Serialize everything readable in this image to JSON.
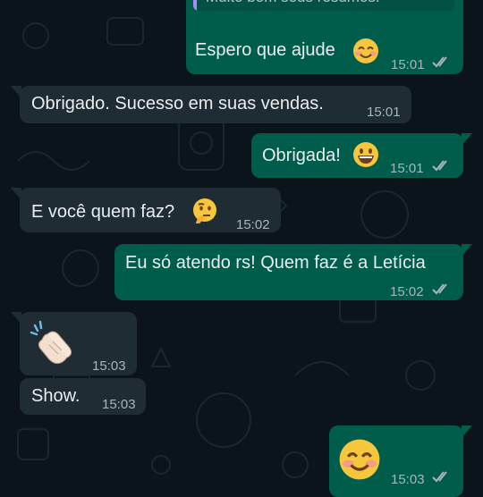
{
  "chat": {
    "colors": {
      "outgoing": "#005c4b",
      "incoming": "#202c33",
      "read_ticks": "#a8b5bc"
    },
    "messages": [
      {
        "direction": "out",
        "quoted_text": "Muito bom seus resumos.",
        "text": "Espero que ajude",
        "emoji": "smiling-face-icon",
        "time": "15:01",
        "status": "read"
      },
      {
        "direction": "in",
        "text": "Obrigado. Sucesso em suas vendas.",
        "time": "15:01"
      },
      {
        "direction": "out",
        "text": "Obrigada!",
        "emoji": "grinning-face-icon",
        "time": "15:01",
        "status": "read"
      },
      {
        "direction": "in",
        "text": "E você quem faz?",
        "emoji": "thinking-face-icon",
        "time": "15:02"
      },
      {
        "direction": "out",
        "text": "Eu só atendo rs! Quem faz é a Letícia",
        "time": "15:02",
        "status": "read"
      },
      {
        "direction": "in",
        "emoji": "clapping-hands-icon",
        "time": "15:03"
      },
      {
        "direction": "in",
        "text": "Show.",
        "time": "15:03"
      },
      {
        "direction": "out",
        "emoji": "smiling-face-icon",
        "time": "15:03",
        "status": "read"
      }
    ]
  }
}
